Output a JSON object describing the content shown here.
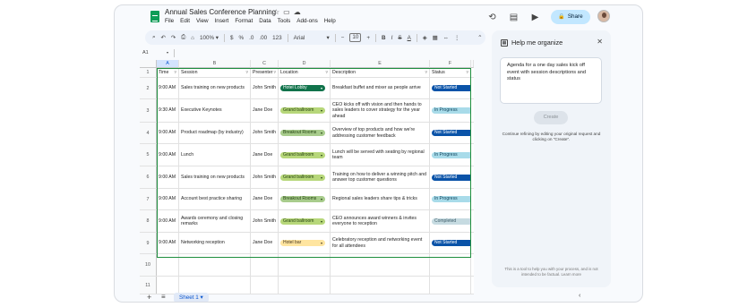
{
  "app": {
    "doc_title": "Annual Sales Conference Planning",
    "menu": [
      "File",
      "Edit",
      "View",
      "Insert",
      "Format",
      "Data",
      "Tools",
      "Add-ons",
      "Help"
    ],
    "share_label": "Share"
  },
  "toolbar": {
    "zoom": "100%",
    "currency": "$",
    "percent": "%",
    "decimal_dec": ".0",
    "decimal_inc": ".00",
    "number_format": "123",
    "font": "Arial",
    "font_size": "10",
    "bold": "B",
    "italic": "I",
    "strike": "S",
    "text_color": "A"
  },
  "formula_bar": {
    "name_box": "A1"
  },
  "grid": {
    "col_letters": [
      "A",
      "B",
      "C",
      "D",
      "E",
      "F"
    ],
    "headers": [
      "Time",
      "Session",
      "Presenter",
      "Location",
      "Description",
      "Status"
    ],
    "rows": [
      {
        "num": "2",
        "time": "9:00 AM",
        "session": "Sales training on new products",
        "presenter": "John Smith",
        "location": "Hotel Lobby",
        "description": "Breakfast buffet and mixer as people arrive",
        "status": "Not Started"
      },
      {
        "num": "3",
        "time": "9:30 AM",
        "session": "Executive Keynotes",
        "presenter": "Jane Doe",
        "location": "Grand ballroom",
        "description": "CEO kicks off with vision and then hands to sales leaders to cover strategy for the year ahead",
        "status": "In Progress"
      },
      {
        "num": "4",
        "time": "9:00 AM",
        "session": "Product roadmap (by industry)",
        "presenter": "John Smith",
        "location": "Breakout Rooms",
        "description": "Overview of top products and how we're addressing customer feedback",
        "status": "Not Started"
      },
      {
        "num": "5",
        "time": "9:00 AM",
        "session": "Lunch",
        "presenter": "Jane Doe",
        "location": "Grand ballroom",
        "description": "Lunch will be served with seating by regional team",
        "status": "In Progress"
      },
      {
        "num": "6",
        "time": "9:00 AM",
        "session": "Sales training on new products",
        "presenter": "John Smith",
        "location": "Grand ballroom",
        "description": "Training on how to deliver a winning pitch and answer top customer questions",
        "status": "Not Started"
      },
      {
        "num": "7",
        "time": "9:00 AM",
        "session": "Account best practice sharing",
        "presenter": "Jane Doe",
        "location": "Breakout Rooms",
        "description": "Regional sales leaders share tips & tricks",
        "status": "In Progress"
      },
      {
        "num": "8",
        "time": "9:00 AM",
        "session": "Awards ceremony and closing remarks",
        "presenter": "John Smith",
        "location": "Grand ballroom",
        "description": "CEO announces award winners & invites everyone to reception",
        "status": "Completed"
      },
      {
        "num": "9",
        "time": "9:00 AM",
        "session": "Networking reception",
        "presenter": "Jane Doe",
        "location": "Hotel bar",
        "description": "Celebratory reception and networking event for all attendees",
        "status": "Not Started"
      }
    ],
    "empty_rows": [
      "10",
      "11"
    ]
  },
  "chip_colors": {
    "Hotel Lobby": {
      "bg": "#11734b",
      "fg": "#ffffff"
    },
    "Grand ballroom": {
      "bg": "#b7d77a",
      "fg": "#1f3d0c"
    },
    "Breakout Rooms": {
      "bg": "#a8cc8c",
      "fg": "#1f3d0c"
    },
    "Hotel bar": {
      "bg": "#ffe5a0",
      "fg": "#473822"
    },
    "Not Started": {
      "bg": "#0a53a8",
      "fg": "#ffffff"
    },
    "In Progress": {
      "bg": "#a8dbe9",
      "fg": "#0a3d56"
    },
    "Completed": {
      "bg": "#c6dbe1",
      "fg": "#3c5b68"
    }
  },
  "sheets": {
    "active": "Sheet 1"
  },
  "panel": {
    "title": "Help me organize",
    "prompt": "Agenda for a one day sales kick off event with session descriptions and status",
    "create_label": "Create",
    "hint": "Continue refining by editing your original request and clicking on \"Create\".",
    "disclaimer": "This is a tool to help you with your process, and is not intended to be factual. Learn more"
  }
}
